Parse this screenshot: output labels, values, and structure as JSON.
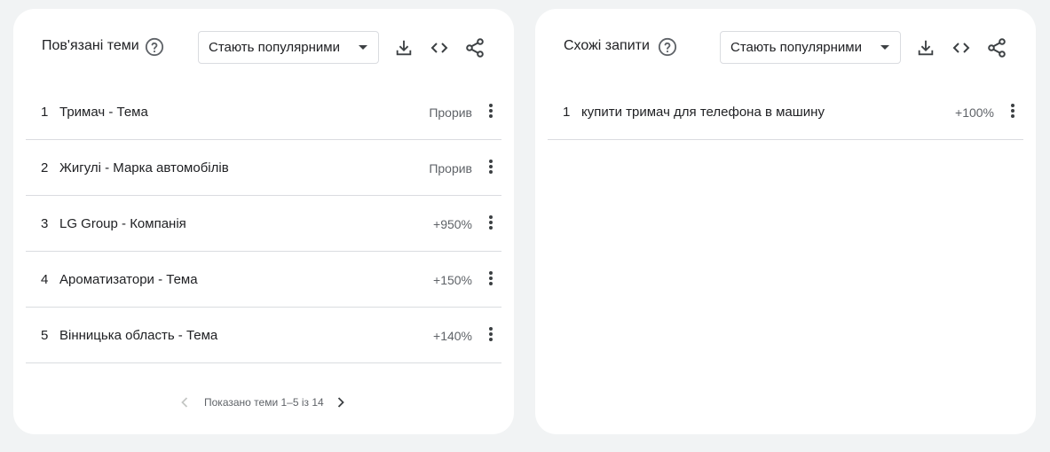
{
  "related_topics": {
    "title": "Пов'язані теми",
    "help_icon": "help-circle-icon",
    "sort_dropdown": {
      "selected": "Стають популярними"
    },
    "tools": [
      "download-icon",
      "embed-code-icon",
      "share-icon"
    ],
    "rows": [
      {
        "rank": "1",
        "label": "Тримач - Тема",
        "value": "Прорив"
      },
      {
        "rank": "2",
        "label": "Жигулі - Марка автомобілів",
        "value": "Прорив"
      },
      {
        "rank": "3",
        "label": "LG Group - Компанія",
        "value": "+950%"
      },
      {
        "rank": "4",
        "label": "Ароматизатори - Тема",
        "value": "+150%"
      },
      {
        "rank": "5",
        "label": "Вінницька область - Тема",
        "value": "+140%"
      }
    ],
    "pagination": {
      "text": "Показано теми 1–5 із 14"
    }
  },
  "related_queries": {
    "title": "Схожі запити",
    "help_icon": "help-circle-icon",
    "sort_dropdown": {
      "selected": "Стають популярними"
    },
    "tools": [
      "download-icon",
      "embed-code-icon",
      "share-icon"
    ],
    "rows": [
      {
        "rank": "1",
        "label": "купити тримач для телефона в машину",
        "value": "+100%"
      }
    ]
  },
  "colors": {
    "background": "#f1f3f4",
    "card": "#ffffff",
    "text_primary": "#202124",
    "text_secondary": "#5f6368",
    "divider": "#dadce0"
  }
}
